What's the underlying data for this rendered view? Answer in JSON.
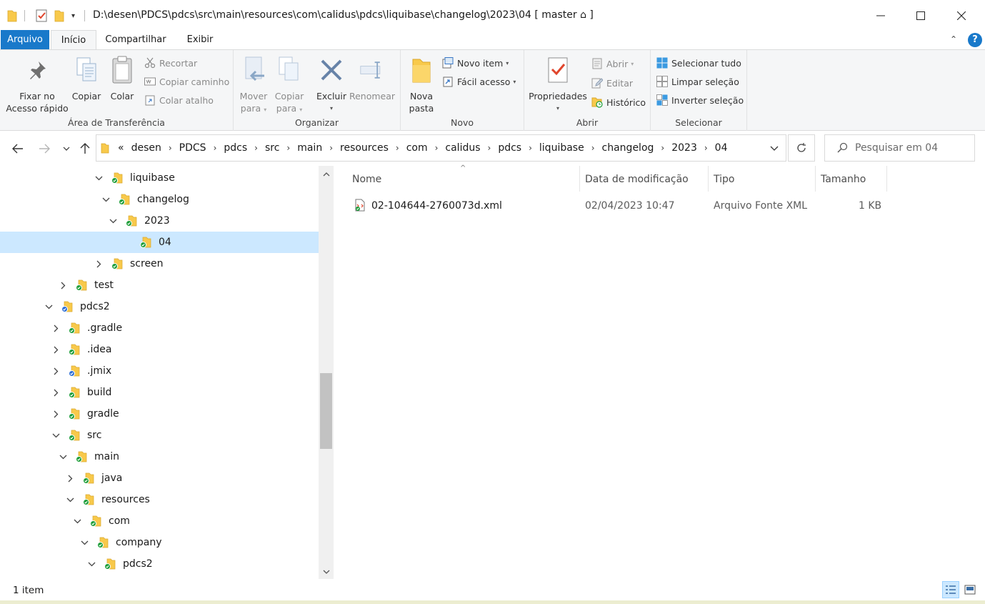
{
  "window": {
    "title": "D:\\desen\\PDCS\\pdcs\\src\\main\\resources\\com\\calidus\\pdcs\\liquibase\\changelog\\2023\\04 [ master ⌂ ]",
    "minimize_icon": "minimize-icon",
    "maximize_icon": "maximize-icon",
    "close_icon": "close-icon"
  },
  "ribbon_tabs": [
    {
      "label": "Arquivo"
    },
    {
      "label": "Início"
    },
    {
      "label": "Compartilhar"
    },
    {
      "label": "Exibir"
    }
  ],
  "ribbon": {
    "clipboard": {
      "label": "Área de Transferência",
      "pin_line1": "Fixar no",
      "pin_line2": "Acesso rápido",
      "copy": "Copiar",
      "paste": "Colar",
      "cut": "Recortar",
      "copy_path": "Copiar caminho",
      "paste_shortcut": "Colar atalho"
    },
    "organize": {
      "label": "Organizar",
      "move_line1": "Mover",
      "move_line2": "para",
      "copy_line1": "Copiar",
      "copy_line2": "para",
      "delete": "Excluir",
      "rename": "Renomear"
    },
    "new": {
      "label": "Novo",
      "folder_line1": "Nova",
      "folder_line2": "pasta",
      "new_item": "Novo item",
      "easy_access": "Fácil acesso"
    },
    "open": {
      "label": "Abrir",
      "properties": "Propriedades",
      "open": "Abrir",
      "edit": "Editar",
      "history": "Histórico"
    },
    "select": {
      "label": "Selecionar",
      "select_all": "Selecionar tudo",
      "select_none": "Limpar seleção",
      "invert": "Inverter seleção"
    }
  },
  "address": {
    "overflow": "«",
    "crumbs": [
      "desen",
      "PDCS",
      "pdcs",
      "src",
      "main",
      "resources",
      "com",
      "calidus",
      "pdcs",
      "liquibase",
      "changelog",
      "2023",
      "04"
    ]
  },
  "search": {
    "placeholder": "Pesquisar em 04"
  },
  "tree": [
    {
      "label": "liquibase",
      "expanded": true
    },
    {
      "label": "changelog",
      "expanded": true
    },
    {
      "label": "2023",
      "expanded": true
    },
    {
      "label": "04",
      "selected": true
    },
    {
      "label": "screen",
      "expanded": false
    },
    {
      "label": "test",
      "expanded": false
    },
    {
      "label": "pdcs2",
      "expanded": true
    },
    {
      "label": ".gradle",
      "expanded": false
    },
    {
      "label": ".idea",
      "expanded": false
    },
    {
      "label": ".jmix",
      "expanded": false
    },
    {
      "label": "build",
      "expanded": false
    },
    {
      "label": "gradle",
      "expanded": false
    },
    {
      "label": "src",
      "expanded": true
    },
    {
      "label": "main",
      "expanded": true
    },
    {
      "label": "java",
      "expanded": false
    },
    {
      "label": "resources",
      "expanded": true
    },
    {
      "label": "com",
      "expanded": true
    },
    {
      "label": "company",
      "expanded": true
    },
    {
      "label": "pdcs2",
      "expanded": true
    }
  ],
  "columns": {
    "name": "Nome",
    "modified": "Data de modificação",
    "type": "Tipo",
    "size": "Tamanho"
  },
  "files": [
    {
      "name": "02-104644-2760073d.xml",
      "modified": "02/04/2023 10:47",
      "type": "Arquivo Fonte XML",
      "size": "1 KB"
    }
  ],
  "status": {
    "count": "1 item"
  },
  "colors": {
    "file_tab": "#1979ca",
    "selection": "#cce8ff",
    "folder": "#f8c94b",
    "sync_ok": "#1e9e3a",
    "sync_pending": "#2f6fd6"
  }
}
